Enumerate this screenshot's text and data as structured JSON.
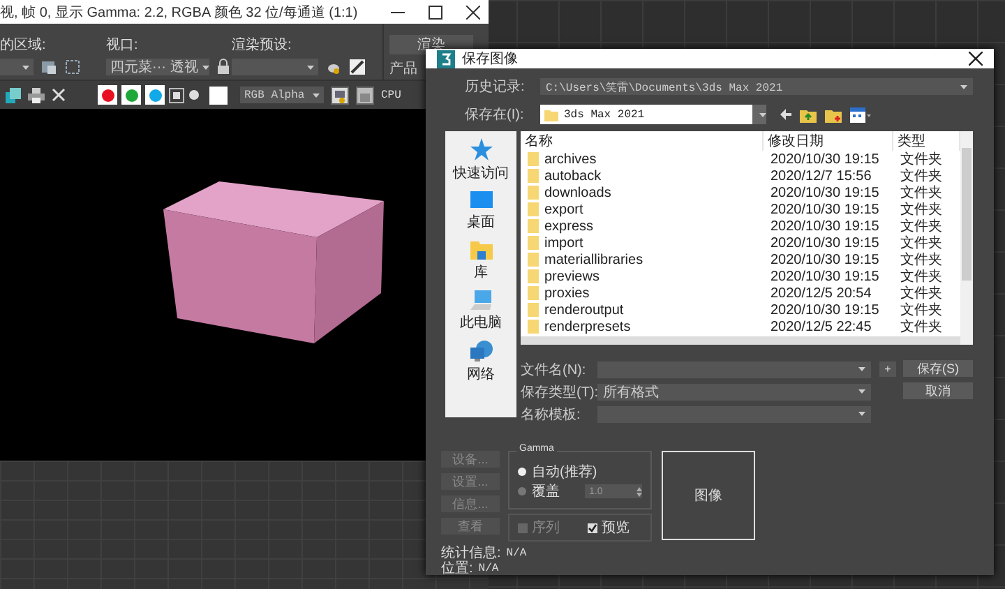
{
  "render_frame": {
    "title": "视, 帧 0, 显示 Gamma: 2.2, RGBA 颜色 32 位/每通道 (1:1)",
    "area_label": "的区域:",
    "viewport_label": "视口:",
    "viewport_value": "四元菜··· 透视",
    "preset_label": "渲染预设:",
    "channels": [
      {
        "color": "#e81123"
      },
      {
        "color": "#1fa83a"
      },
      {
        "color": "#12a9e8"
      }
    ],
    "display_mode": "RGB Alpha",
    "engine": "CPU"
  },
  "render_panel": {
    "render_button": "渲染",
    "quality": "产品"
  },
  "dialog": {
    "title": "保存图像",
    "history_label": "历史记录:",
    "history_value": "C:\\Users\\笑雷\\Documents\\3ds Max 2021",
    "save_in_label": "保存在(I):",
    "save_in_value": "3ds Max 2021",
    "places": [
      {
        "kind": "star",
        "label": "快速访问"
      },
      {
        "kind": "desktop",
        "label": "桌面"
      },
      {
        "kind": "library",
        "label": "库"
      },
      {
        "kind": "computer",
        "label": "此电脑"
      },
      {
        "kind": "network",
        "label": "网络"
      }
    ],
    "columns": [
      "名称",
      "修改日期",
      "类型"
    ],
    "rows": [
      {
        "name": "archives",
        "date": "2020/10/30 19:15",
        "type": "文件夹"
      },
      {
        "name": "autoback",
        "date": "2020/12/7 15:56",
        "type": "文件夹"
      },
      {
        "name": "downloads",
        "date": "2020/10/30 19:15",
        "type": "文件夹"
      },
      {
        "name": "export",
        "date": "2020/10/30 19:15",
        "type": "文件夹"
      },
      {
        "name": "express",
        "date": "2020/10/30 19:15",
        "type": "文件夹"
      },
      {
        "name": "import",
        "date": "2020/10/30 19:15",
        "type": "文件夹"
      },
      {
        "name": "materiallibraries",
        "date": "2020/10/30 19:15",
        "type": "文件夹"
      },
      {
        "name": "previews",
        "date": "2020/10/30 19:15",
        "type": "文件夹"
      },
      {
        "name": "proxies",
        "date": "2020/12/5 20:54",
        "type": "文件夹"
      },
      {
        "name": "renderoutput",
        "date": "2020/10/30 19:15",
        "type": "文件夹"
      },
      {
        "name": "renderpresets",
        "date": "2020/12/5 22:45",
        "type": "文件夹"
      }
    ],
    "filename_label": "文件名(N):",
    "type_label": "保存类型(T):",
    "type_value": "所有格式",
    "template_label": "名称模板:",
    "plus_button": "+",
    "save_button": "保存(S)",
    "cancel_button": "取消",
    "side_buttons": [
      {
        "label": "设备...",
        "disabled": true
      },
      {
        "label": "设置...",
        "disabled": true
      },
      {
        "label": "信息...",
        "disabled": true
      },
      {
        "label": "查看",
        "disabled": true
      }
    ],
    "gamma": {
      "title": "Gamma",
      "options": [
        {
          "label": "自动(推荐)",
          "selected": true
        },
        {
          "label": "覆盖",
          "selected": false
        }
      ],
      "override_value": "1.0"
    },
    "checks": [
      {
        "label": "序列",
        "checked": false,
        "disabled": true
      },
      {
        "label": "预览",
        "checked": true,
        "disabled": false
      }
    ],
    "preview_label": "图像",
    "stats": [
      {
        "label": "统计信息:",
        "value": "N/A"
      },
      {
        "label": "位置:",
        "value": "N/A"
      }
    ]
  }
}
